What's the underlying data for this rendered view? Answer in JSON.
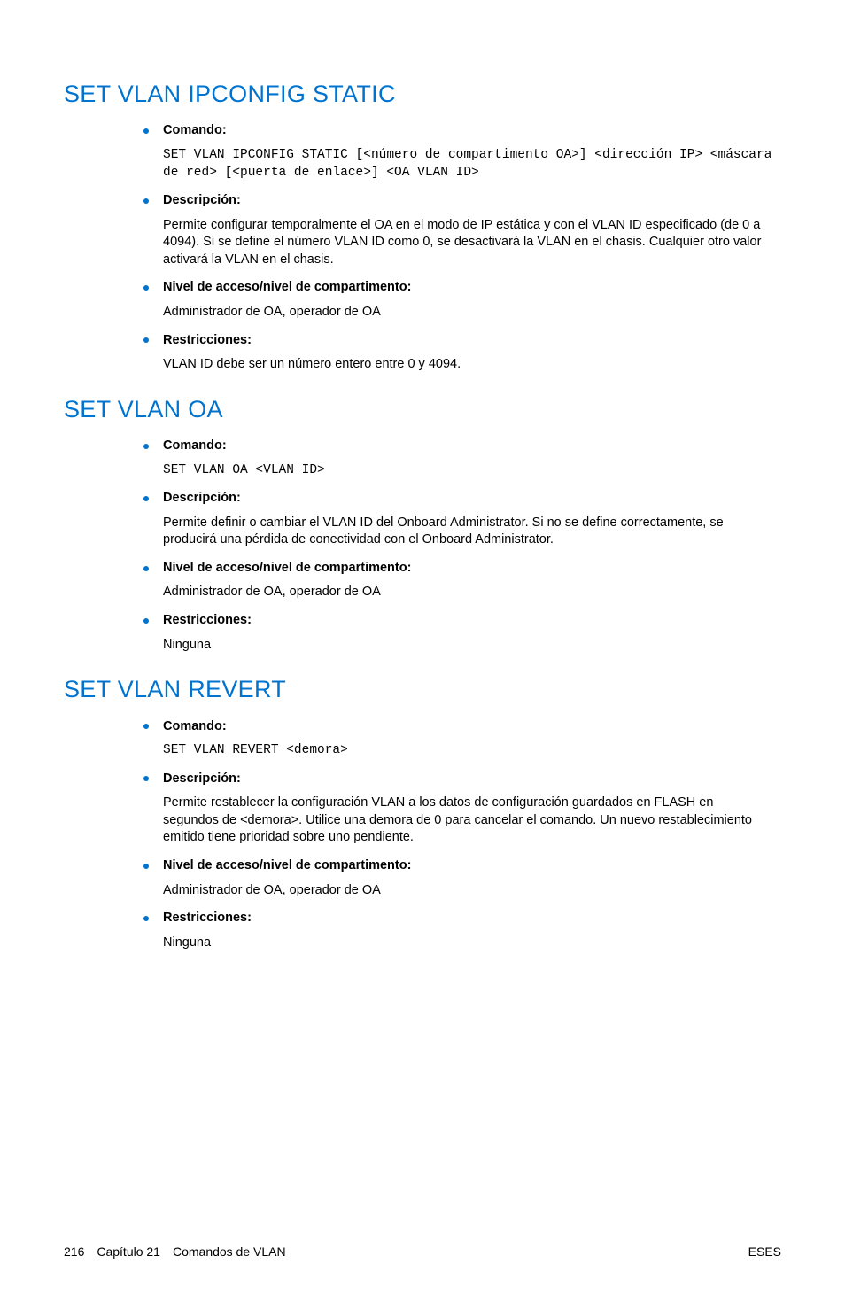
{
  "sections": [
    {
      "title": "SET VLAN IPCONFIG STATIC",
      "items": [
        {
          "label": "Comando:",
          "body": "SET VLAN IPCONFIG STATIC [<número de compartimento OA>] <dirección IP> <máscara de red> [<puerta de enlace>] <OA VLAN ID>",
          "mono": true
        },
        {
          "label": "Descripción:",
          "body": "Permite configurar temporalmente el OA en el modo de IP estática y con el VLAN ID especificado (de 0 a 4094). Si se define el número VLAN ID como 0, se desactivará la VLAN en el chasis. Cualquier otro valor activará la VLAN en el chasis."
        },
        {
          "label": "Nivel de acceso/nivel de compartimento:",
          "body": "Administrador de OA, operador de OA"
        },
        {
          "label": "Restricciones:",
          "body": "VLAN ID debe ser un número entero entre 0 y 4094."
        }
      ]
    },
    {
      "title": "SET VLAN OA",
      "items": [
        {
          "label": "Comando:",
          "body": "SET VLAN OA <VLAN ID>",
          "mono": true
        },
        {
          "label": "Descripción:",
          "body": "Permite definir o cambiar el VLAN ID del Onboard Administrator. Si no se define correctamente, se producirá una pérdida de conectividad con el Onboard Administrator."
        },
        {
          "label": "Nivel de acceso/nivel de compartimento:",
          "body": "Administrador de OA, operador de OA"
        },
        {
          "label": "Restricciones:",
          "body": "Ninguna"
        }
      ]
    },
    {
      "title": "SET VLAN REVERT",
      "items": [
        {
          "label": "Comando:",
          "body": "SET VLAN REVERT <demora>",
          "mono": true
        },
        {
          "label": "Descripción:",
          "body": "Permite restablecer la configuración VLAN a los datos de configuración guardados en FLASH en segundos de <demora>. Utilice una demora de 0 para cancelar el comando. Un nuevo restablecimiento emitido tiene prioridad sobre uno pendiente."
        },
        {
          "label": "Nivel de acceso/nivel de compartimento:",
          "body": "Administrador de OA, operador de OA"
        },
        {
          "label": "Restricciones:",
          "body": "Ninguna"
        }
      ]
    }
  ],
  "footer": {
    "page": "216",
    "chapter": "Capítulo 21",
    "subject": "Comandos de VLAN",
    "right": "ESES"
  }
}
